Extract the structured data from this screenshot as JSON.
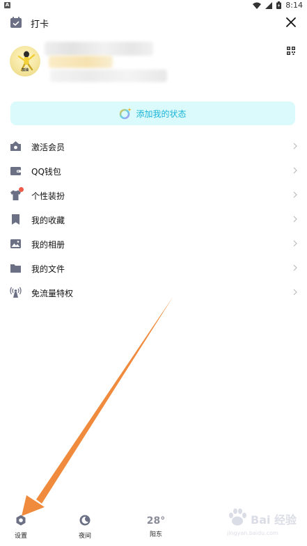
{
  "status_bar": {
    "time": "8:14",
    "app_badge": "A"
  },
  "header": {
    "checkin_label": "打卡"
  },
  "status_button": {
    "label": "添加我的状态"
  },
  "menu": [
    {
      "label": "激活会员",
      "icon": "member-icon"
    },
    {
      "label": "QQ钱包",
      "icon": "wallet-icon"
    },
    {
      "label": "个性装扮",
      "icon": "dressup-icon",
      "badge": true
    },
    {
      "label": "我的收藏",
      "icon": "bookmark-icon"
    },
    {
      "label": "我的相册",
      "icon": "album-icon"
    },
    {
      "label": "我的文件",
      "icon": "folder-icon"
    },
    {
      "label": "免流量特权",
      "icon": "antenna-icon"
    }
  ],
  "bottom": {
    "settings_label": "设置",
    "night_label": "夜间",
    "weather_temp": "28°",
    "weather_city": "阳东"
  },
  "watermark": {
    "text": "Bai 经验",
    "url": "jingyan.baidu.com"
  },
  "colors": {
    "accent": "#19b4d6",
    "status_bg": "#dbfafc",
    "icon_gray": "#6c7084",
    "arrow": "#f08a3c",
    "badge_red": "#f05a4a"
  }
}
